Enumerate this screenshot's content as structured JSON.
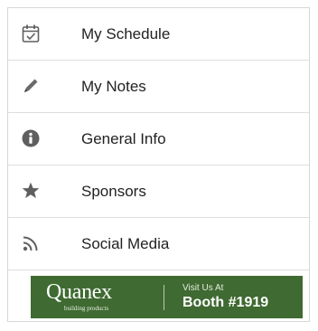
{
  "menu": {
    "items": [
      {
        "icon": "calendar-icon",
        "label": "My Schedule"
      },
      {
        "icon": "pencil-icon",
        "label": "My Notes"
      },
      {
        "icon": "info-icon",
        "label": "General Info"
      },
      {
        "icon": "star-icon",
        "label": "Sponsors"
      },
      {
        "icon": "rss-icon",
        "label": "Social Media"
      }
    ]
  },
  "banner": {
    "brand_name": "Quanex",
    "brand_tagline": "building products",
    "visit_text": "Visit Us At",
    "booth_text": "Booth #1919",
    "background_color": "#3f6a31"
  },
  "colors": {
    "icon": "#5f5f5f",
    "text": "#222222",
    "separator": "#dedede"
  }
}
